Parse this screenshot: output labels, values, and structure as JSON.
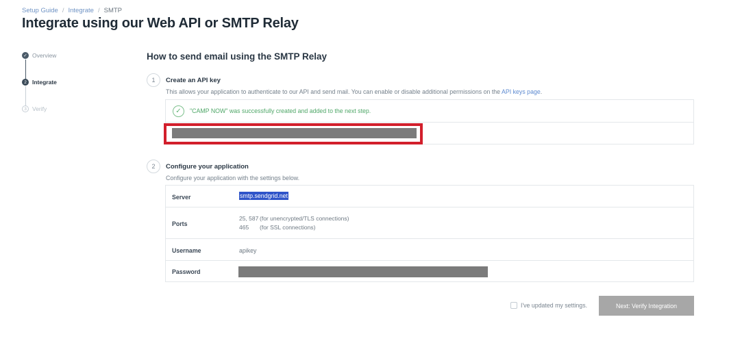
{
  "breadcrumb": {
    "items": [
      "Setup Guide",
      "Integrate",
      "SMTP"
    ],
    "separator": "/"
  },
  "page_title": "Integrate using our Web API or SMTP Relay",
  "stepper": {
    "steps": [
      {
        "label": "Overview",
        "state": "completed",
        "icon": "check-icon"
      },
      {
        "label": "Integrate",
        "state": "current",
        "number": "2"
      },
      {
        "label": "Verify",
        "state": "upcoming",
        "number": "3"
      }
    ]
  },
  "section_title": "How to send email using the SMTP Relay",
  "step1": {
    "number": "1",
    "title": "Create an API key",
    "description": "This allows your application to authenticate to our API and send mail. You can enable or disable additional permissions on the",
    "link_text": "API keys page",
    "link_suffix": ".",
    "success_message": "\"CAMP NOW\" was successfully created and added to the next step."
  },
  "step2": {
    "number": "2",
    "title": "Configure your application",
    "description": "Configure your application with the settings below.",
    "rows": {
      "server": {
        "label": "Server",
        "value": "smtp.sendgrid.net"
      },
      "ports": {
        "label": "Ports",
        "lines": [
          {
            "port": "25, 587",
            "note": "(for unencrypted/TLS connections)"
          },
          {
            "port": "465",
            "note": "(for SSL connections)"
          }
        ]
      },
      "username": {
        "label": "Username",
        "value": "apikey"
      },
      "password": {
        "label": "Password"
      }
    }
  },
  "footer": {
    "checkbox_label": "I've updated my settings.",
    "next_button": "Next: Verify Integration"
  },
  "colors": {
    "success": "#4fa768",
    "highlight": "#d21f2c",
    "selection": "#2f54c9",
    "button_disabled": "#a7a7a7"
  }
}
